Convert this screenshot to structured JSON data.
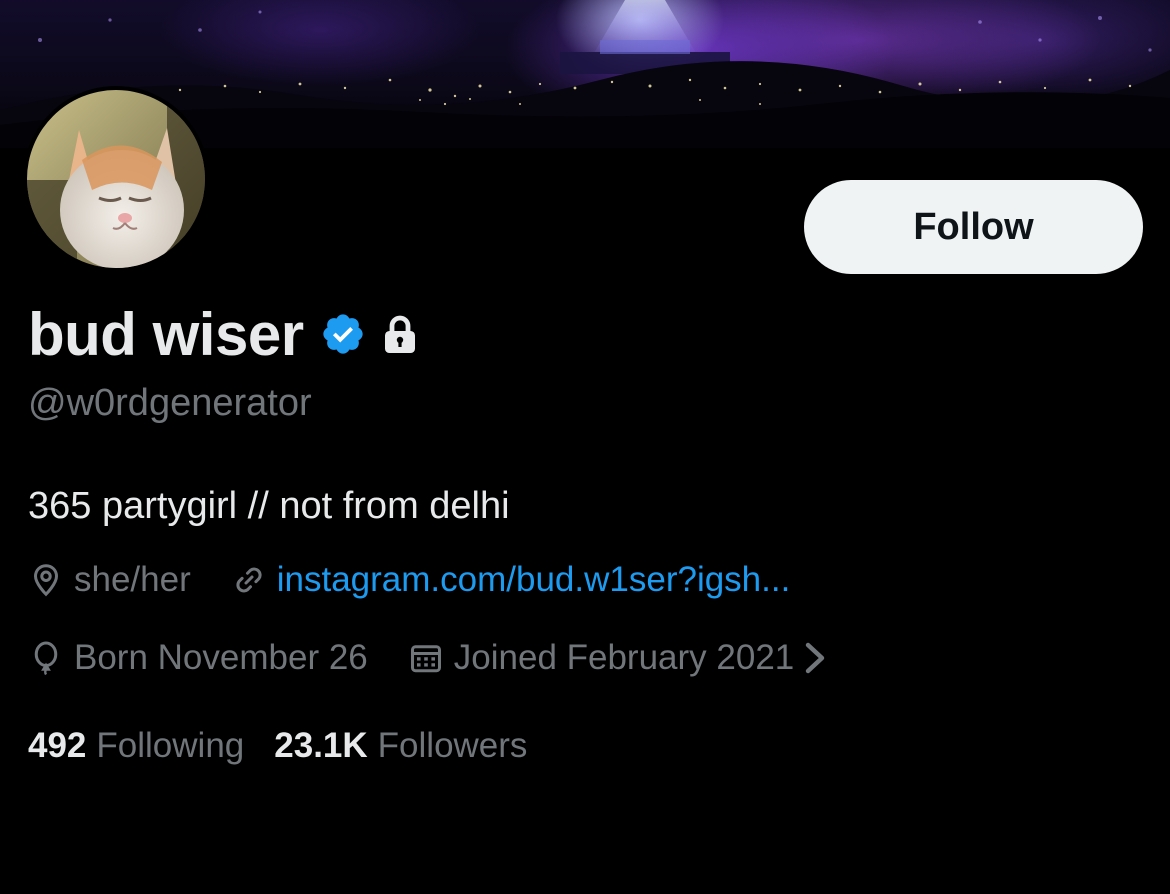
{
  "profile": {
    "display_name": "bud wiser",
    "handle": "@w0rdgenerator",
    "bio": "365 partygirl // not from delhi",
    "verified": true,
    "protected": true,
    "avatar_icon": "cat-avatar",
    "banner_icon": "concert-crowd-banner"
  },
  "actions": {
    "follow_label": "Follow"
  },
  "meta": {
    "location": "she/her",
    "location_icon": "location-pin-icon",
    "website": "instagram.com/bud.w1ser?igsh...",
    "website_icon": "link-icon",
    "birthday": "Born November 26",
    "birthday_icon": "balloon-icon",
    "joined": "Joined February 2021",
    "joined_icon": "calendar-icon"
  },
  "stats": {
    "following_count": "492",
    "following_label": "Following",
    "followers_count": "23.1K",
    "followers_label": "Followers"
  },
  "colors": {
    "background": "#000000",
    "primary_text": "#e7e9ea",
    "secondary_text": "#71767b",
    "link": "#1d9bf0",
    "verified_badge": "#1d9bf0",
    "follow_button_bg": "#eff3f4",
    "follow_button_text": "#0f1419"
  }
}
